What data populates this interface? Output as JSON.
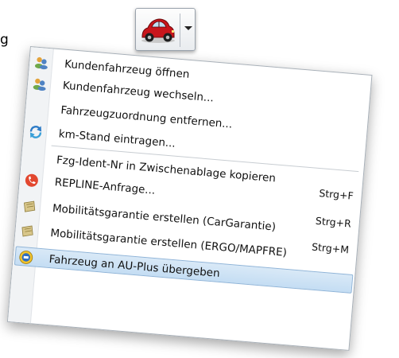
{
  "edge_text": "g",
  "button": {
    "icon": "car-icon",
    "dropdown_icon": "chevron-down-icon"
  },
  "menu": {
    "items": [
      {
        "label": "Kundenfahrzeug öffnen",
        "shortcut": "",
        "icon": "people-icon"
      },
      {
        "label": "Kundenfahrzeug wechseln...",
        "shortcut": "",
        "icon": "people-icon"
      },
      {
        "label": "Fahrzeugzuordnung entfernen...",
        "shortcut": "",
        "icon": ""
      },
      {
        "label": "km-Stand eintragen...",
        "shortcut": "",
        "icon": "refresh-icon"
      },
      {
        "label": "Fzg-Ident-Nr in Zwischenablage kopieren",
        "shortcut": "Strg+F",
        "icon": ""
      },
      {
        "label": "REPLINE-Anfrage...",
        "shortcut": "",
        "icon": "repline-icon"
      },
      {
        "label": "Mobilitätsgarantie erstellen (CarGarantie)",
        "shortcut": "Strg+R",
        "icon": "document-icon"
      },
      {
        "label": "Mobilitätsgarantie erstellen (ERGO/MAPFRE)",
        "shortcut": "Strg+M",
        "icon": "document-icon"
      },
      {
        "label": "Fahrzeug an AU-Plus übergeben",
        "shortcut": "",
        "icon": "au-plus-icon"
      }
    ]
  }
}
